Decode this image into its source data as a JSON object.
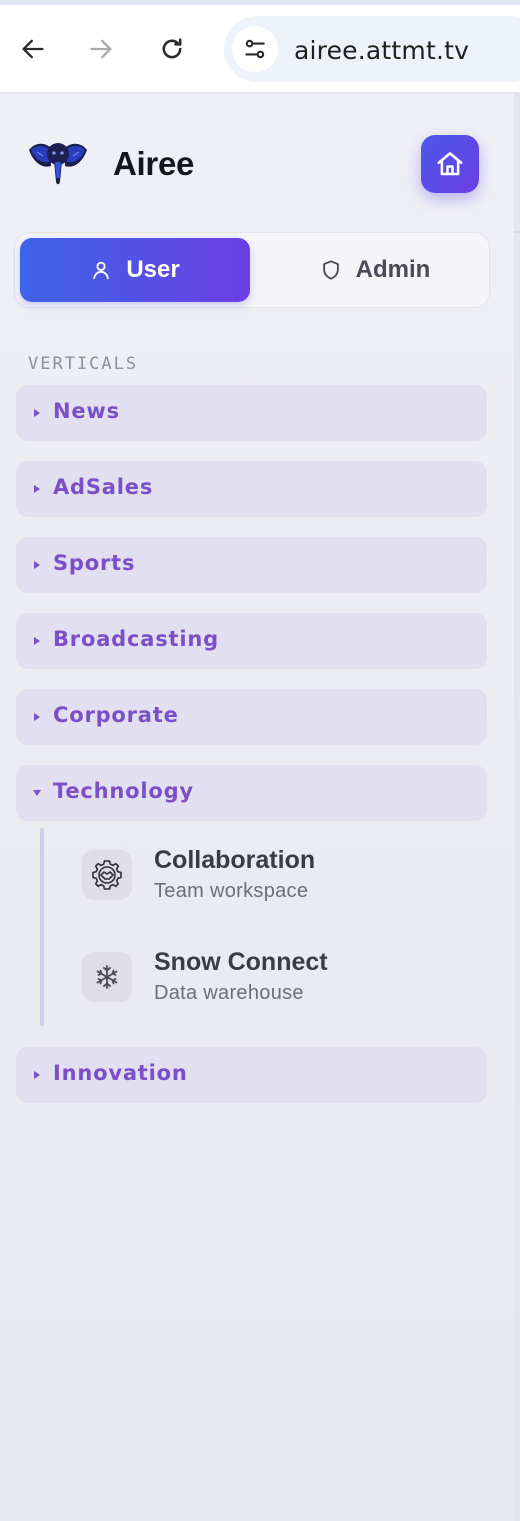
{
  "browser": {
    "url": "airee.attmt.tv",
    "icons": {
      "back": "arrow-left-icon",
      "forward": "arrow-right-icon",
      "reload": "reload-icon",
      "site_info": "tune-icon"
    }
  },
  "brand": {
    "name": "Airee",
    "logo": "elephant-logo",
    "home_icon": "home-icon"
  },
  "role_toggle": {
    "options": [
      {
        "label": "User",
        "icon": "person-icon",
        "active": true
      },
      {
        "label": "Admin",
        "icon": "shield-icon",
        "active": false
      }
    ]
  },
  "sidebar": {
    "section_label": "VERTICALS",
    "verticals": [
      {
        "label": "News",
        "expanded": false
      },
      {
        "label": "AdSales",
        "expanded": false
      },
      {
        "label": "Sports",
        "expanded": false
      },
      {
        "label": "Broadcasting",
        "expanded": false
      },
      {
        "label": "Corporate",
        "expanded": false
      },
      {
        "label": "Technology",
        "expanded": true,
        "children": [
          {
            "title": "Collaboration",
            "subtitle": "Team workspace",
            "icon": "handshake-gear-icon"
          },
          {
            "title": "Snow Connect",
            "subtitle": "Data warehouse",
            "icon": "snowflake-icon"
          }
        ]
      },
      {
        "label": "Innovation",
        "expanded": false
      }
    ]
  },
  "colors": {
    "accent_start": "#3d63e8",
    "accent_end": "#6b3fe3",
    "vertical_text": "#7a4fc8",
    "vertical_bg": "#e2dff0",
    "sidebar_bg": "#eeeef5"
  }
}
